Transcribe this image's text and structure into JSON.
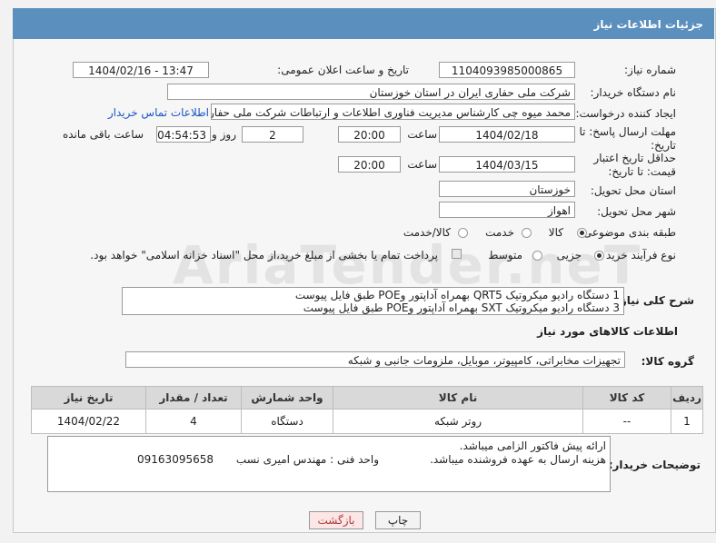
{
  "header": {
    "title": "جزئیات اطلاعات نیاز"
  },
  "fields": {
    "need_number_label": "شماره نیاز:",
    "need_number": "1104093985000865",
    "announce_label": "تاریخ و ساعت اعلان عمومی:",
    "announce_value": "1404/02/16 - 13:47",
    "buyer_org_label": "نام دستگاه خریدار:",
    "buyer_org": "شرکت ملی حفاری ایران در استان خوزستان",
    "creator_label": "ایجاد کننده درخواست:",
    "creator": "محمد میوه چی کارشناس مدیریت فناوری اطلاعات و ارتباطات  شرکت ملی حفاری ایران",
    "contact_link": "اطلاعات تماس خریدار",
    "reply_deadline_label": "مهلت ارسال پاسخ: تا تاریخ:",
    "reply_date": "1404/02/18",
    "time_label": "ساعت",
    "reply_time": "20:00",
    "days_value": "2",
    "days_label": "روز و",
    "remaining_time": "04:54:53",
    "remaining_label": "ساعت باقی مانده",
    "price_validity_label": "حداقل تاریخ اعتبار قیمت: تا تاریخ:",
    "price_date": "1404/03/15",
    "price_time": "20:00",
    "province_label": "استان محل تحویل:",
    "province": "خوزستان",
    "city_label": "شهر محل تحویل:",
    "city": "اهواز",
    "category_label": "طبقه بندی موضوعی:",
    "category_options": [
      "کالا",
      "خدمت",
      "کالا/خدمت"
    ],
    "process_label": "نوع فرآیند خرید :",
    "process_options": [
      "جزیی",
      "متوسط"
    ],
    "payment_note": "پرداخت تمام یا بخشی از مبلغ خرید،از محل \"اسناد خزانه اسلامی\" خواهد بود.",
    "description_label": "شرح کلی نیاز:",
    "description_line1": "1 دستگاه رادیو میکروتیک QRT5 بهمراه آداپتور وPOE       طبق فایل پیوست",
    "description_line2": "3 دستگاه رادیو میکروتیک SXT بهمراه آداپتور وPOE       طبق فایل پیوست"
  },
  "goods": {
    "section_title": "اطلاعات کالاهای مورد نیاز",
    "group_label": "گروه کالا:",
    "group_value": "تجهیزات مخابراتی، کامپیوتر، موبایل، ملزومات جانبی و شبکه",
    "columns": [
      "ردیف",
      "کد کالا",
      "نام کالا",
      "واحد شمارش",
      "تعداد / مقدار",
      "تاریخ نیاز"
    ],
    "rows": [
      [
        "1",
        "--",
        "روتر شبکه",
        "دستگاه",
        "4",
        "1404/02/22"
      ]
    ]
  },
  "buyer_notes": {
    "label": "توضیحات خریدار:",
    "line1": "ارائه پیش فاکتور الزامی میباشد.",
    "line2": "هزینه ارسال به عهده فروشنده میباشد.",
    "unit_text": "واحد فنی : مهندس امیری نسب",
    "phone": "09163095658"
  },
  "buttons": {
    "print": "چاپ",
    "back": "بازگشت"
  },
  "watermark": "AriaTender.neT"
}
